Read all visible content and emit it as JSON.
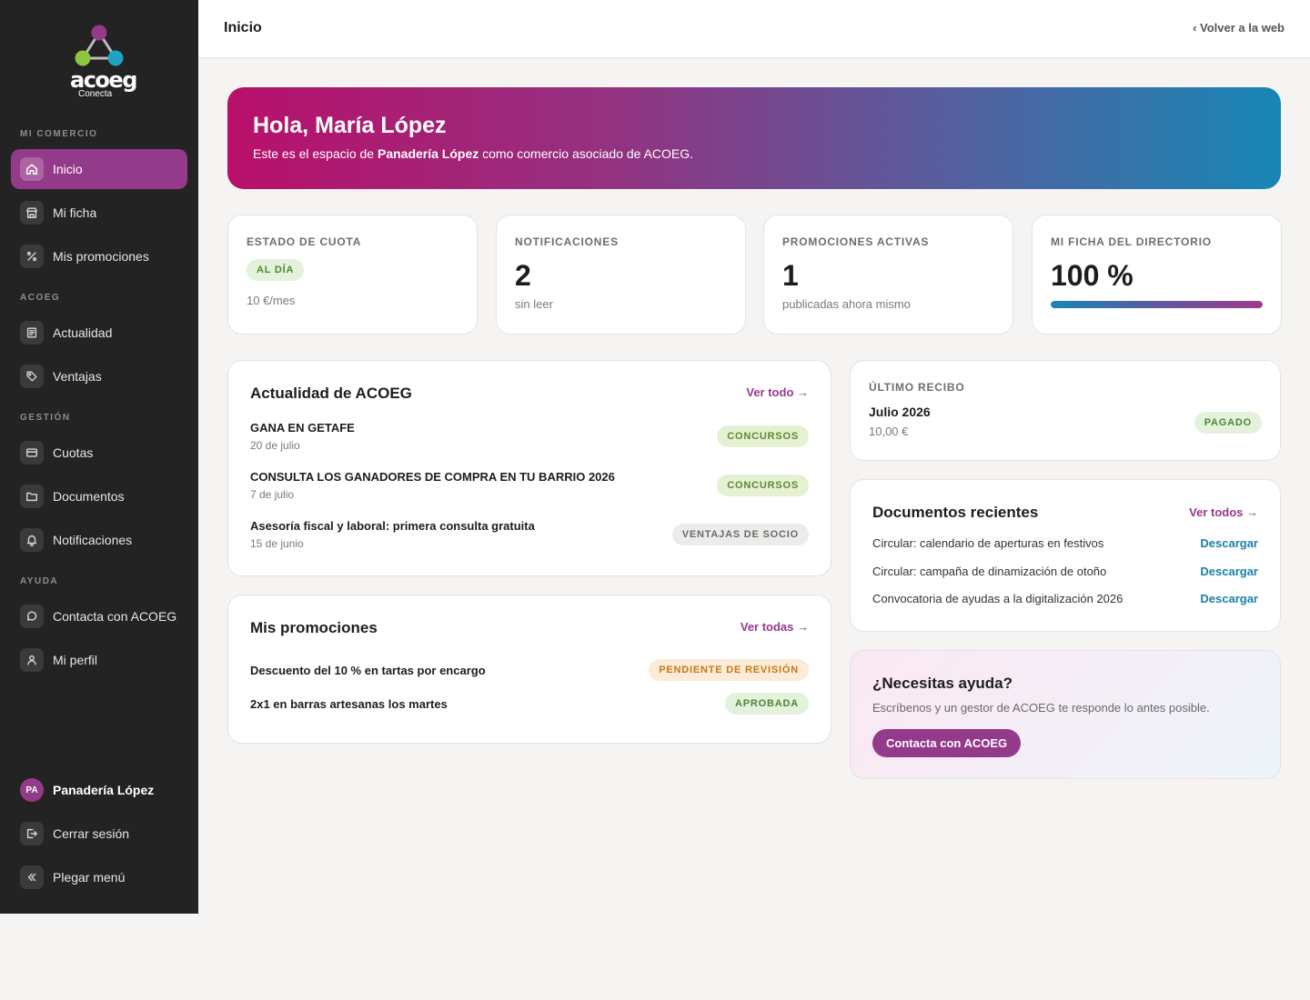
{
  "brand": {
    "name": "acoeg",
    "sub": "Conecta"
  },
  "sidebar": {
    "sections": [
      {
        "label": "MI COMERCIO"
      },
      {
        "label": "ACOEG"
      },
      {
        "label": "GESTIÓN"
      },
      {
        "label": "AYUDA"
      }
    ],
    "items": [
      {
        "label": "Inicio",
        "icon": "home-icon"
      },
      {
        "label": "Mi ficha",
        "icon": "store-icon"
      },
      {
        "label": "Mis promociones",
        "icon": "percent-icon"
      },
      {
        "label": "Actualidad",
        "icon": "newspaper-icon"
      },
      {
        "label": "Ventajas",
        "icon": "tag-icon"
      },
      {
        "label": "Cuotas",
        "icon": "card-icon"
      },
      {
        "label": "Documentos",
        "icon": "folder-icon"
      },
      {
        "label": "Notificaciones",
        "icon": "bell-icon"
      },
      {
        "label": "Contacta con ACOEG",
        "icon": "chat-icon"
      },
      {
        "label": "Mi perfil",
        "icon": "user-icon"
      }
    ],
    "user": {
      "initials": "PA",
      "name": "Panadería López"
    },
    "logout": "Cerrar sesión",
    "collapse": "Plegar menú"
  },
  "topbar": {
    "title": "Inicio",
    "back": "‹ Volver a la web"
  },
  "hero": {
    "greeting": "Hola, María López",
    "pre": "Este es el espacio de ",
    "business": "Panadería López",
    "post": " como comercio asociado de ACOEG."
  },
  "stats": {
    "fee": {
      "label": "ESTADO DE CUOTA",
      "badge": "AL DÍA",
      "sub": "10 €/mes"
    },
    "notifications": {
      "label": "NOTIFICACIONES",
      "value": "2",
      "sub": "sin leer"
    },
    "promotions": {
      "label": "PROMOCIONES ACTIVAS",
      "value": "1",
      "sub": "publicadas ahora mismo"
    },
    "directory": {
      "label": "MI FICHA DEL DIRECTORIO",
      "value": "100 %",
      "progress": 100
    }
  },
  "news": {
    "title": "Actualidad de ACOEG",
    "link": "Ver todo →",
    "items": [
      {
        "title": "GANA EN GETAFE",
        "date": "20 de julio",
        "tag": "CONCURSOS"
      },
      {
        "title": "CONSULTA LOS GANADORES DE COMPRA EN TU BARRIO 2026",
        "date": "7 de julio",
        "tag": "CONCURSOS"
      },
      {
        "title": "Asesoría fiscal y laboral: primera consulta gratuita",
        "date": "15 de junio",
        "tag": "VENTAJAS DE SOCIO"
      }
    ]
  },
  "promos": {
    "title": "Mis promociones",
    "link": "Ver todas →",
    "items": [
      {
        "title": "Descuento del 10 % en tartas por encargo",
        "status": "PENDIENTE DE REVISIÓN"
      },
      {
        "title": "2x1 en barras artesanas los martes",
        "status": "APROBADA"
      }
    ]
  },
  "receipt": {
    "label": "ÚLTIMO RECIBO",
    "period": "Julio 2026",
    "amount": "10,00 €",
    "status": "PAGADO"
  },
  "docs": {
    "title": "Documentos recientes",
    "link": "Ver todos →",
    "download": "Descargar",
    "items": [
      {
        "name": "Circular: calendario de aperturas en festivos"
      },
      {
        "name": "Circular: campaña de dinamización de otoño"
      },
      {
        "name": "Convocatoria de ayudas a la digitalización 2026"
      }
    ]
  },
  "help": {
    "title": "¿Necesitas ayuda?",
    "text": "Escríbenos y un gestor de ACOEG te responde lo antes posible.",
    "button": "Contacta con ACOEG"
  },
  "colors": {
    "accent": "#943a8a",
    "sidebar": "#232323",
    "link_blue": "#1b7fa8"
  }
}
